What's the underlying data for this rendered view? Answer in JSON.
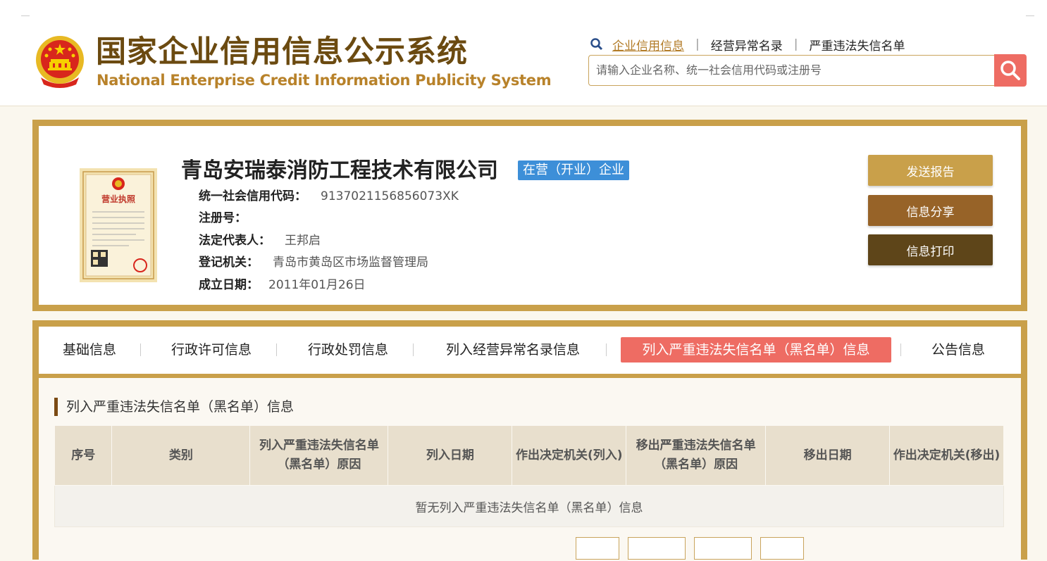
{
  "site": {
    "title_cn": "国家企业信用信息公示系统",
    "title_en": "National Enterprise Credit Information Publicity System"
  },
  "top_nav": {
    "items": [
      "企业信用信息",
      "经营异常名录",
      "严重违法失信名单"
    ],
    "active": "企业信用信息"
  },
  "search": {
    "placeholder": "请输入企业名称、统一社会信用代码或注册号"
  },
  "company": {
    "name": "青岛安瑞泰消防工程技术有限公司",
    "status": "在营（开业）企业",
    "credit_code_label": "统一社会信用代码：",
    "credit_code": "9137021156856073XK",
    "reg_no_label": "注册号：",
    "reg_no": "",
    "legal_rep_label": "法定代表人：",
    "legal_rep": "王邦启",
    "authority_label": "登记机关：",
    "authority": "青岛市黄岛区市场监督管理局",
    "founded_label": "成立日期：",
    "founded": "2011年01月26日"
  },
  "license_image": {
    "title": "营业执照"
  },
  "actions": {
    "send_report": "发送报告",
    "share": "信息分享",
    "print": "信息打印"
  },
  "colors": {
    "gold_border": "#c9a04a",
    "btn_send": "#c9a04a",
    "btn_share": "#976328",
    "btn_print": "#5e4519",
    "active_tab": "#ee6c63",
    "status_badge": "#3d8fd8"
  },
  "tabs": [
    "基础信息",
    "行政许可信息",
    "行政处罚信息",
    "列入经营异常名录信息",
    "列入严重违法失信名单（黑名单）信息",
    "公告信息"
  ],
  "active_tab_index": 4,
  "section": {
    "title": "列入严重违法失信名单（黑名单）信息",
    "columns": [
      "序号",
      "类别",
      "列入严重违法失信名单（黑名单）原因",
      "列入日期",
      "作出决定机关(列入)",
      "移出严重违法失信名单（黑名单）原因",
      "移出日期",
      "作出决定机关(移出)"
    ],
    "empty_message": "暂无列入严重违法失信名单（黑名单）信息"
  }
}
